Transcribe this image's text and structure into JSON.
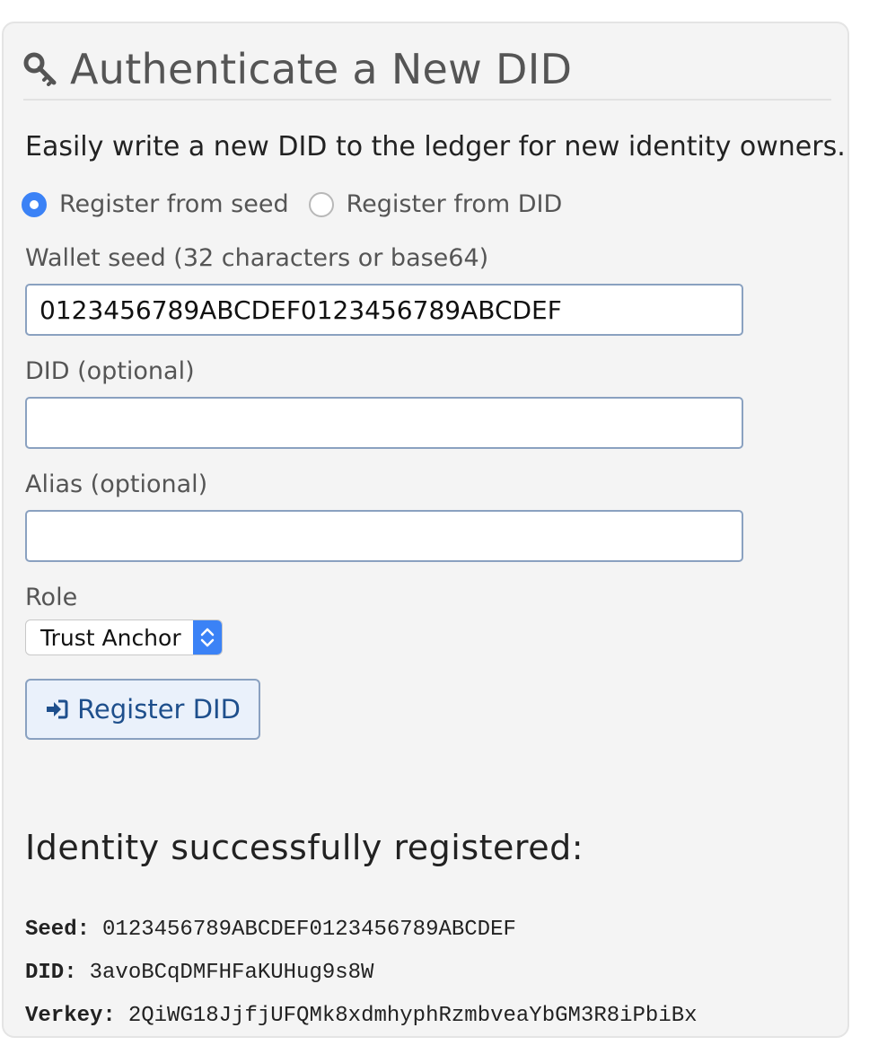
{
  "panel": {
    "title": "Authenticate a New DID",
    "title_icon": "key-icon",
    "intro": "Easily write a new DID to the ledger for new identity owners."
  },
  "registration_mode": {
    "options": [
      {
        "label": "Register from seed",
        "checked": true
      },
      {
        "label": "Register from DID",
        "checked": false
      }
    ]
  },
  "form": {
    "seed": {
      "label": "Wallet seed (32 characters or base64)",
      "value": "0123456789ABCDEF0123456789ABCDEF"
    },
    "did": {
      "label": "DID (optional)",
      "value": ""
    },
    "alias": {
      "label": "Alias (optional)",
      "value": ""
    },
    "role": {
      "label": "Role",
      "selected": "Trust Anchor"
    },
    "submit_label": "Register DID",
    "submit_icon": "sign-in-icon"
  },
  "result": {
    "heading": "Identity successfully registered:",
    "seed_label": "Seed:",
    "seed_value": "0123456789ABCDEF0123456789ABCDEF",
    "did_label": "DID:",
    "did_value": "3avoBCqDMFHFaKUHug9s8W",
    "verkey_label": "Verkey:",
    "verkey_value": "2QiWG18JjfjUFQMk8xdmhyphRzmbveaYbGM3R8iPbiBx"
  },
  "colors": {
    "accent": "#3b82f6",
    "button_text": "#1e4f8c",
    "panel_bg": "#f4f4f4"
  }
}
